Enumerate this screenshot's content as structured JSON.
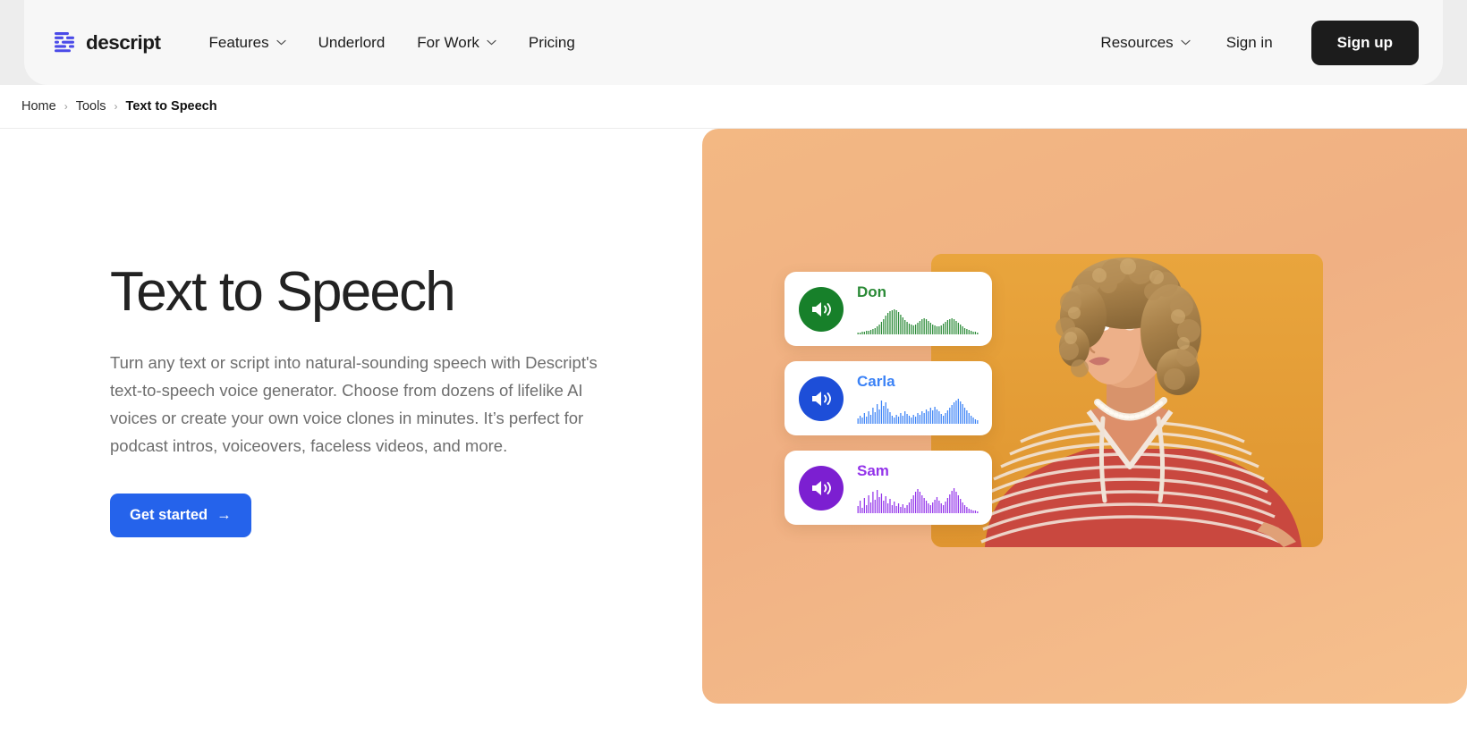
{
  "brand": {
    "name": "descript",
    "logo_icon": "descript-waveform-logo"
  },
  "nav": {
    "items": [
      {
        "label": "Features",
        "has_dropdown": true,
        "icon": "chevron-down-icon"
      },
      {
        "label": "Underlord",
        "has_dropdown": false,
        "icon": ""
      },
      {
        "label": "For Work",
        "has_dropdown": true,
        "icon": "chevron-down-icon"
      },
      {
        "label": "Pricing",
        "has_dropdown": false,
        "icon": ""
      }
    ],
    "resources": {
      "label": "Resources",
      "icon": "chevron-down-icon"
    },
    "sign_in": "Sign in",
    "sign_up": "Sign up"
  },
  "breadcrumb": {
    "items": [
      "Home",
      "Tools",
      "Text to Speech"
    ],
    "separator": "›"
  },
  "hero": {
    "title": "Text to Speech",
    "description": "Turn any text or script into natural-sounding speech with Descript's text-to-speech voice generator. Choose from dozens of lifelike AI voices or create your own voice clones in minutes. It’s perfect for podcast intros, voiceovers, faceless videos, and more.",
    "cta_label": "Get started",
    "cta_arrow": "→",
    "image_alt": "Woman with curly blonde hair in red and white striped top on orange background"
  },
  "voice_cards": [
    {
      "name": "Don",
      "color": "#17802a",
      "text_color": "#2a8a36",
      "icon": "speaker-wave-icon",
      "wave": [
        2,
        2,
        3,
        3,
        4,
        4,
        5,
        6,
        7,
        9,
        11,
        14,
        17,
        21,
        24,
        26,
        27,
        28,
        27,
        25,
        22,
        19,
        16,
        14,
        12,
        11,
        10,
        11,
        13,
        15,
        17,
        18,
        17,
        15,
        13,
        11,
        10,
        9,
        9,
        10,
        12,
        14,
        16,
        17,
        18,
        17,
        15,
        13,
        11,
        9,
        7,
        6,
        5,
        4,
        3,
        3,
        2
      ]
    },
    {
      "name": "Carla",
      "color": "#1d4ed8",
      "text_color": "#3b82f6",
      "icon": "speaker-wave-icon",
      "wave": [
        6,
        9,
        7,
        12,
        8,
        14,
        10,
        18,
        13,
        22,
        16,
        26,
        20,
        24,
        17,
        13,
        9,
        7,
        10,
        8,
        12,
        9,
        14,
        11,
        9,
        7,
        10,
        8,
        12,
        10,
        14,
        12,
        16,
        14,
        18,
        15,
        19,
        16,
        14,
        11,
        9,
        12,
        15,
        18,
        21,
        24,
        26,
        28,
        25,
        22,
        18,
        15,
        12,
        9,
        7,
        5,
        4
      ]
    },
    {
      "name": "Sam",
      "color": "#7c1fd1",
      "text_color": "#9333ea",
      "icon": "speaker-wave-icon",
      "wave": [
        8,
        14,
        6,
        17,
        9,
        20,
        12,
        24,
        15,
        26,
        18,
        22,
        14,
        19,
        11,
        16,
        9,
        13,
        8,
        11,
        7,
        10,
        6,
        9,
        12,
        16,
        20,
        24,
        27,
        24,
        20,
        17,
        14,
        11,
        9,
        12,
        15,
        18,
        14,
        11,
        9,
        13,
        17,
        21,
        25,
        28,
        24,
        20,
        16,
        12,
        9,
        7,
        5,
        4,
        3,
        3,
        2
      ]
    }
  ],
  "colors": {
    "accent_blue": "#2563eb",
    "logo_blue": "#4a4ae8",
    "panel_orange": "#f0b083",
    "photo_orange": "#e39b34",
    "dark": "#1c1c1c"
  }
}
